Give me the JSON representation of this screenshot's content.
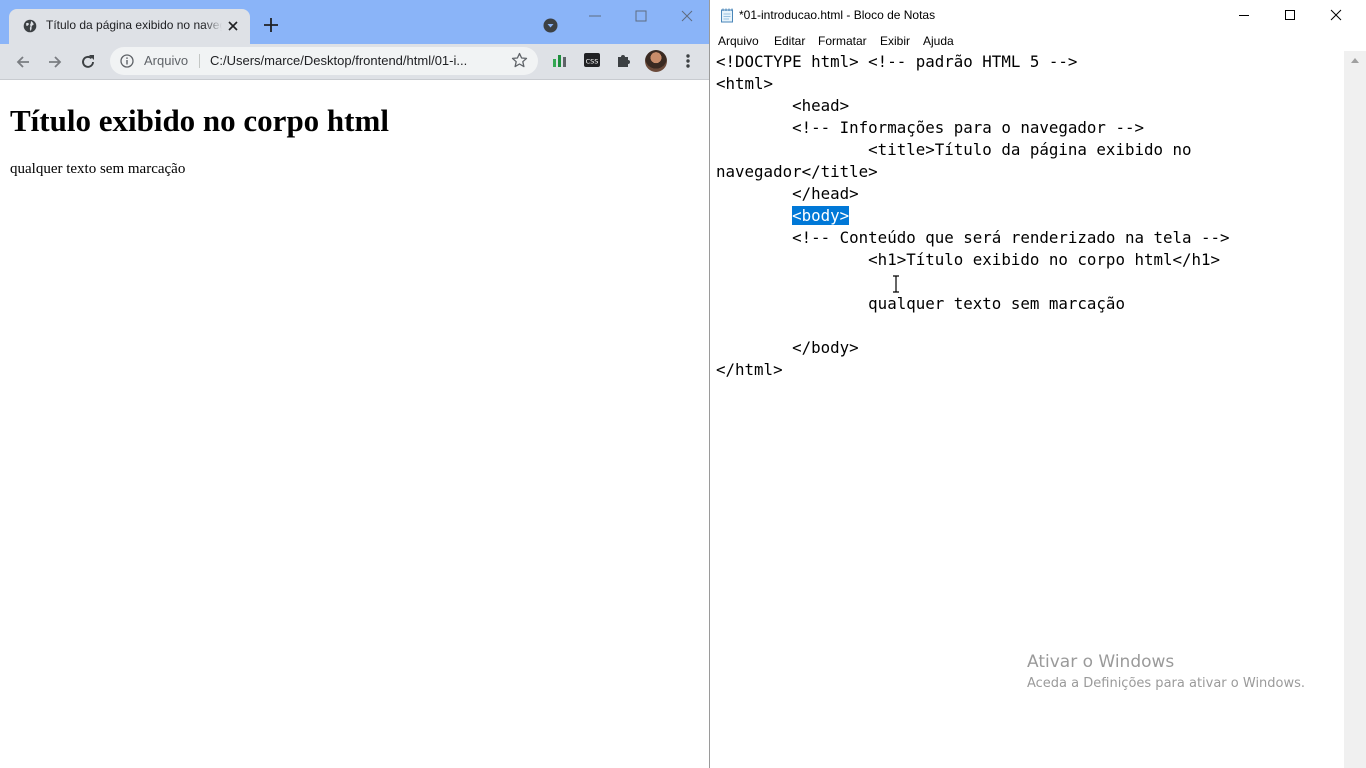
{
  "chrome": {
    "tab": {
      "title": "Título da página exibido no navegador",
      "favicon": "globe-icon",
      "close": "close-icon"
    },
    "newtab": "plus-icon",
    "window_controls": [
      "minimize-icon",
      "maximize-icon",
      "close-icon"
    ],
    "omnibox": {
      "chip": "Arquivo",
      "url": "C:/Users/marce/Desktop/frontend/html/01-i..."
    },
    "extensions": [
      "chart-extension-icon",
      "css-extension-icon",
      "puzzle-icon"
    ],
    "page": {
      "h1": "Título exibido no corpo html",
      "paragraph": "qualquer texto sem marcação"
    }
  },
  "notepad": {
    "title": "*01-introducao.html - Bloco de Notas",
    "menu": [
      "Arquivo",
      "Editar",
      "Formatar",
      "Exibir",
      "Ajuda"
    ],
    "lines": [
      "<!DOCTYPE html> <!-- padrão HTML 5 -->",
      "<html>",
      "        <head>",
      "        <!-- Informações para o navegador -->",
      "                <title>Título da página exibido no",
      "navegador</title>",
      "        </head>",
      "        <body>",
      "        <!-- Conteúdo que será renderizado na tela -->",
      "                <h1>Título exibido no corpo html</h1>",
      "",
      "                qualquer texto sem marcação",
      "",
      "        </body>",
      "</html>"
    ],
    "selection": {
      "line_index": 7,
      "text": "<body>"
    }
  },
  "watermark": {
    "line1": "Ativar o Windows",
    "line2": "Aceda a Definições para ativar o Windows."
  },
  "colors": {
    "chrome_frame": "#8ab4f8",
    "chrome_toolbar": "#dee1e6",
    "selection": "#0078d7"
  }
}
